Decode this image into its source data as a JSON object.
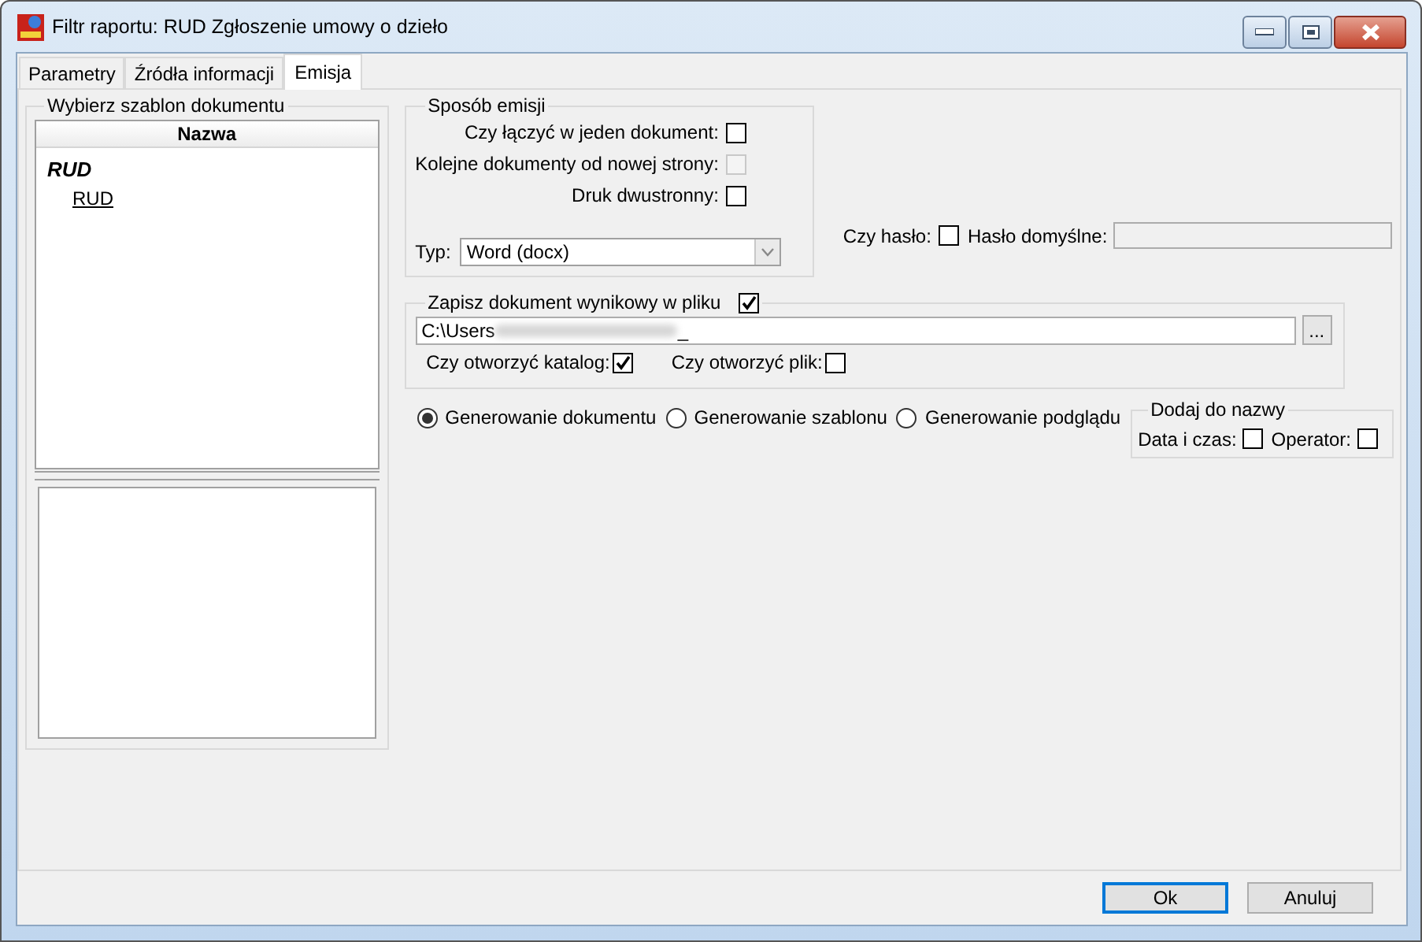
{
  "window": {
    "title": "Filtr raportu: RUD Zgłoszenie umowy o dzieło"
  },
  "tabs": [
    {
      "label": "Parametry",
      "selected": false
    },
    {
      "label": "Źródła informacji",
      "selected": false
    },
    {
      "label": "Emisja",
      "selected": true
    }
  ],
  "template_panel": {
    "title": "Wybierz szablon dokumentu",
    "column": "Nazwa",
    "tree": [
      {
        "label": "RUD",
        "children": [
          {
            "label": "RUD"
          }
        ]
      }
    ]
  },
  "emission_mode": {
    "title": "Sposób emisji",
    "options": [
      {
        "label": "Czy łączyć w jeden dokument:",
        "checked": false,
        "disabled": false
      },
      {
        "label": "Kolejne dokumenty od nowej strony:",
        "checked": false,
        "disabled": true
      },
      {
        "label": "Druk dwustronny:",
        "checked": false,
        "disabled": false
      }
    ],
    "type_label": "Typ:",
    "type_value": "Word (docx)"
  },
  "password": {
    "label": "Czy hasło:",
    "checked": false,
    "default_label": "Hasło domyślne:"
  },
  "save_file": {
    "title": "Zapisz dokument wynikowy w pliku",
    "checked": true,
    "path": "C:\\Users",
    "redacted": true,
    "path_tail": "_",
    "browse": "...",
    "options": [
      {
        "label": "Czy otworzyć katalog:",
        "checked": true
      },
      {
        "label": "Czy otworzyć plik:",
        "checked": false
      }
    ]
  },
  "generation": [
    {
      "label": "Generowanie dokumentu",
      "selected": true
    },
    {
      "label": "Generowanie szablonu",
      "selected": false
    },
    {
      "label": "Generowanie podglądu",
      "selected": false
    }
  ],
  "name_suffix": {
    "title": "Dodaj do nazwy",
    "options": [
      {
        "label": "Data i czas:",
        "checked": false
      },
      {
        "label": "Operator:",
        "checked": false
      }
    ]
  },
  "buttons": [
    {
      "label": "Ok",
      "default": true
    },
    {
      "label": "Anuluj",
      "default": false
    }
  ]
}
